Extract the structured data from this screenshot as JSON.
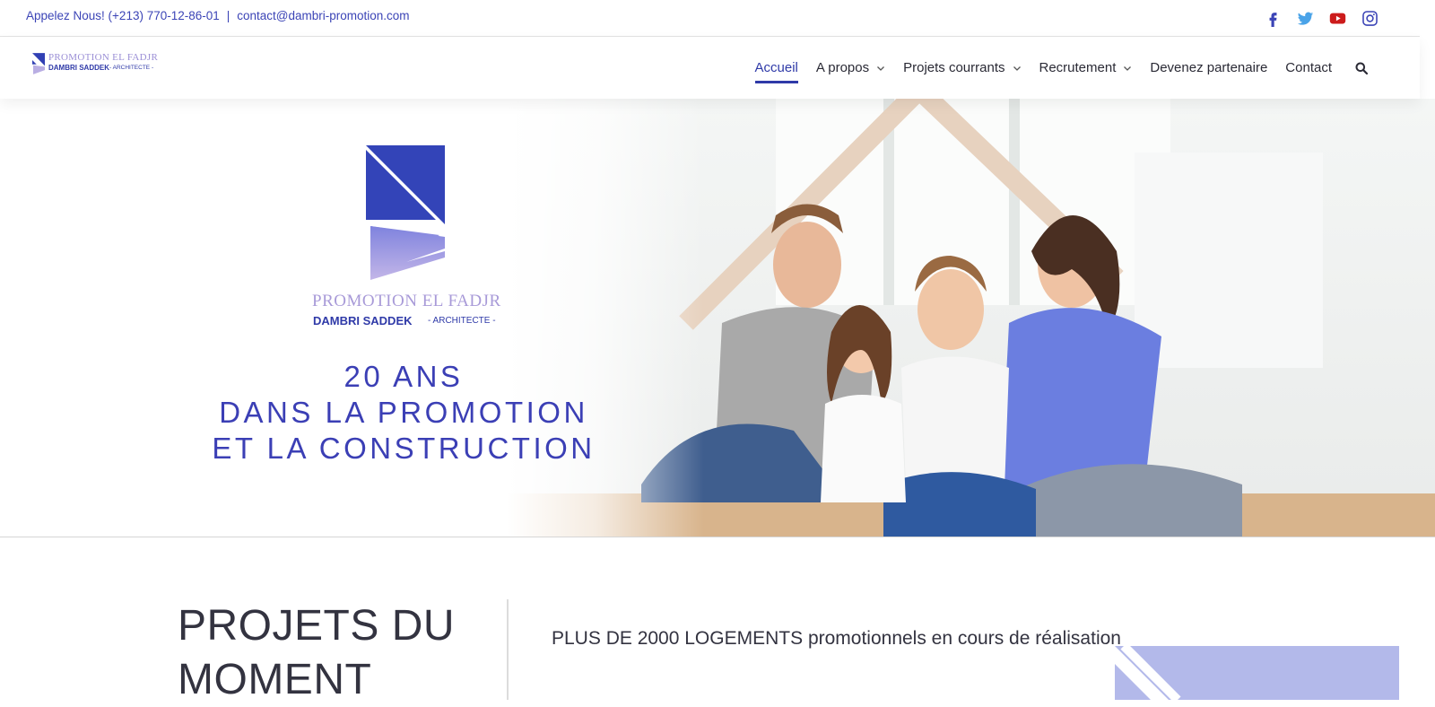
{
  "topbar": {
    "phone": "Appelez Nous! (+213) 770-12-86-01",
    "separator": "|",
    "email": "contact@dambri-promotion.com",
    "socials": [
      "facebook-icon",
      "twitter-icon",
      "youtube-icon",
      "instagram-icon"
    ]
  },
  "header": {
    "logo_line1": "PROMOTION EL FADJR",
    "logo_line2": "DAMBRI SADDEK",
    "logo_line3": "- ARCHITECTE -",
    "nav": [
      {
        "label": "Accueil",
        "active": true,
        "dropdown": false
      },
      {
        "label": "A propos",
        "active": false,
        "dropdown": true
      },
      {
        "label": "Projets courrants",
        "active": false,
        "dropdown": true
      },
      {
        "label": "Recrutement",
        "active": false,
        "dropdown": true
      },
      {
        "label": "Devenez partenaire",
        "active": false,
        "dropdown": false
      },
      {
        "label": "Contact",
        "active": false,
        "dropdown": false
      }
    ],
    "search_icon": "search-icon"
  },
  "hero": {
    "brand_line1": "PROMOTION EL FADJR",
    "brand_line2": "DAMBRI SADDEK",
    "brand_line3": "- ARCHITECTE -",
    "tagline": [
      "20 ANS",
      "DANS LA PROMOTION",
      "ET LA CONSTRUCTION"
    ]
  },
  "projects": {
    "title": [
      "PROJETS DU",
      "MOMENT"
    ],
    "description": "PLUS DE 2000 LOGEMENTS promotionnels en cours de réalisation"
  },
  "colors": {
    "accent": "#2f3aa8",
    "brand_light": "#a89ad8",
    "tagline": "#3b3fb5"
  }
}
